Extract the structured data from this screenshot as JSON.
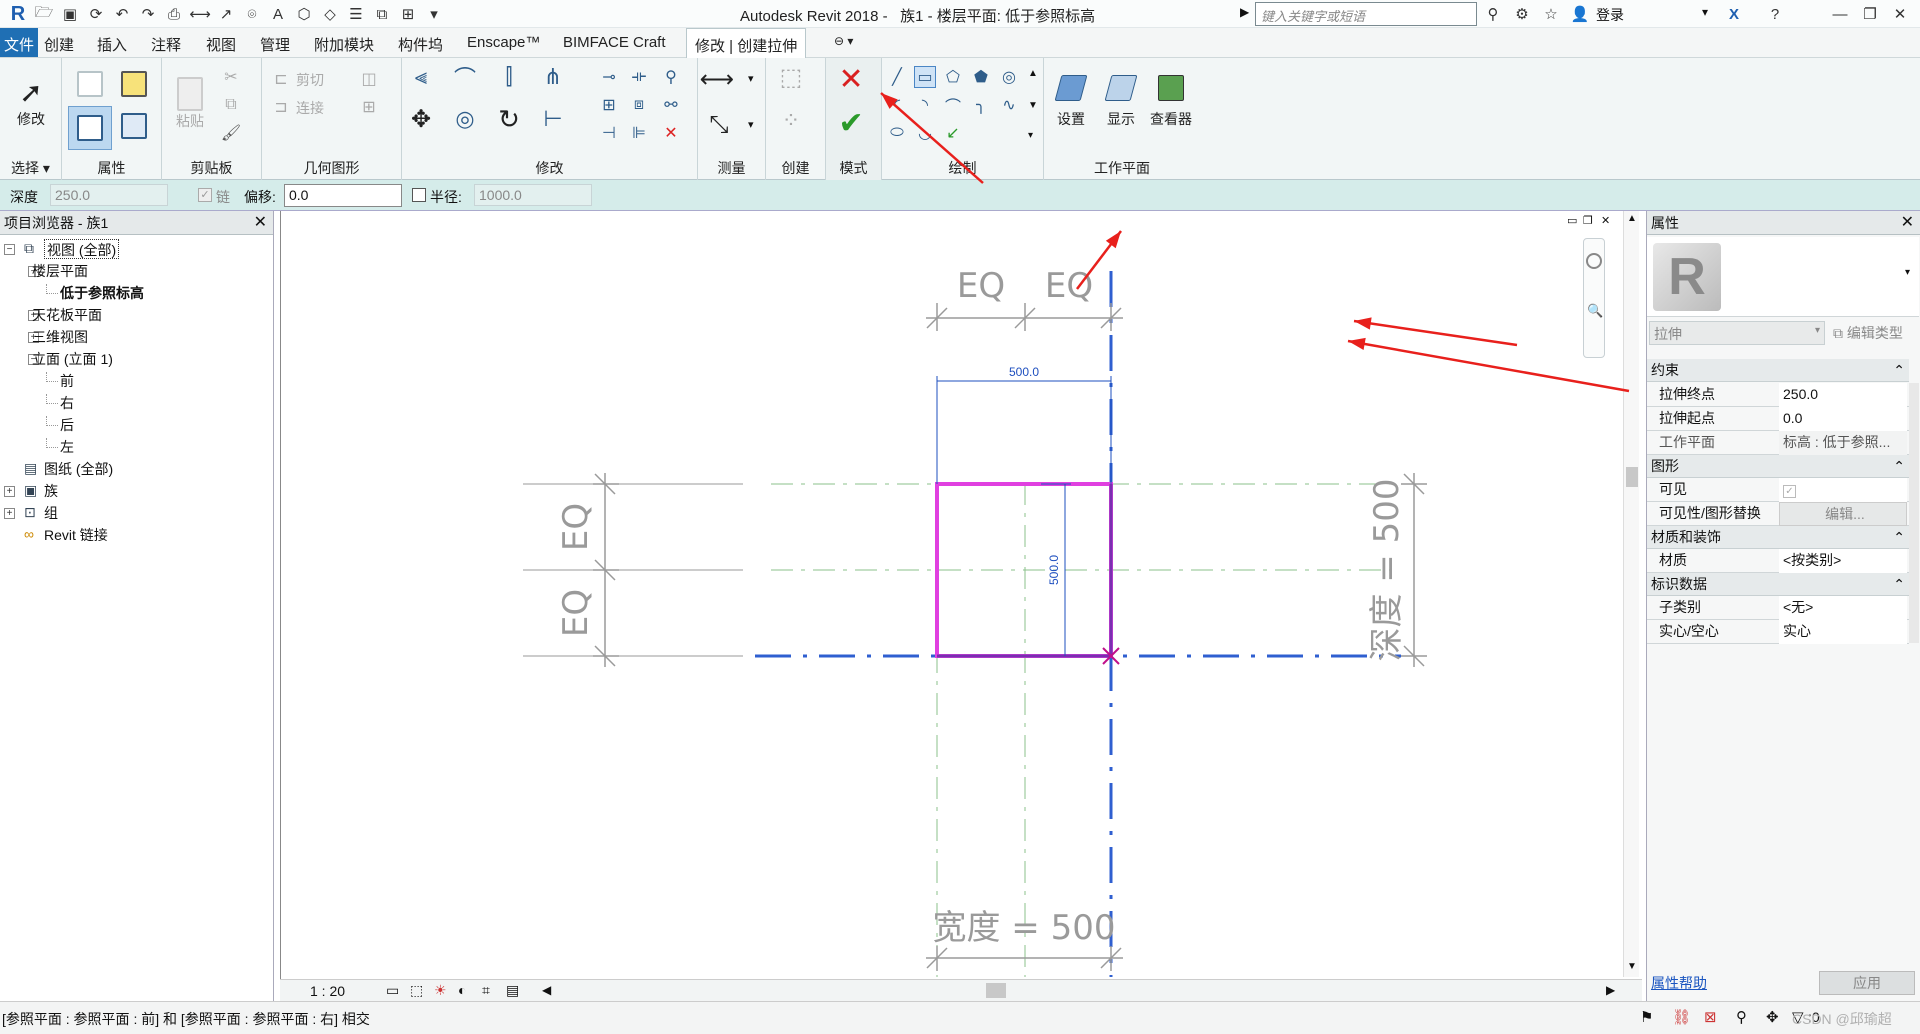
{
  "title_bar": {
    "app_title": "Autodesk Revit 2018 -",
    "doc_title": "族1 - 楼层平面: 低于参照标高",
    "search_placeholder": "键入关键字或短语",
    "login_label": "登录"
  },
  "menu": {
    "items": [
      "文件",
      "创建",
      "插入",
      "注释",
      "视图",
      "管理",
      "附加模块",
      "构件坞",
      "Enscape™",
      "BIMFACE Craft",
      "修改 | 创建拉伸"
    ]
  },
  "ribbon": {
    "select_panel": {
      "modify_label": "修改",
      "panel_label": "选择"
    },
    "properties_panel": {
      "panel_label": "属性"
    },
    "clipboard_panel": {
      "paste_label": "粘贴",
      "cut_label": "剪切",
      "join_label": "连接",
      "panel_label": "剪贴板"
    },
    "geometry_panel": {
      "panel_label": "几何图形"
    },
    "modify_panel": {
      "panel_label": "修改"
    },
    "measure_panel": {
      "panel_label": "测量"
    },
    "create_panel": {
      "panel_label": "创建"
    },
    "mode_panel": {
      "panel_label": "模式"
    },
    "draw_panel": {
      "panel_label": "绘制"
    },
    "workplane_panel": {
      "set_label": "设置",
      "show_label": "显示",
      "viewer_label": "查看器",
      "panel_label": "工作平面"
    }
  },
  "options_bar": {
    "depth_label": "深度",
    "depth_value": "250.0",
    "chain_label": "链",
    "offset_label": "偏移:",
    "offset_value": "0.0",
    "radius_label": "半径:",
    "radius_value": "1000.0"
  },
  "project_browser": {
    "title": "项目浏览器 - 族1",
    "items": [
      {
        "label": "视图 (全部)",
        "expander": "−"
      },
      {
        "label": "楼层平面",
        "expander": "−"
      },
      {
        "label": "低于参照标高",
        "expander": ""
      },
      {
        "label": "天花板平面",
        "expander": "+"
      },
      {
        "label": "三维视图",
        "expander": "+"
      },
      {
        "label": "立面 (立面 1)",
        "expander": "−"
      },
      {
        "label": "前",
        "expander": ""
      },
      {
        "label": "右",
        "expander": ""
      },
      {
        "label": "后",
        "expander": ""
      },
      {
        "label": "左",
        "expander": ""
      },
      {
        "label": "图纸 (全部)",
        "expander": ""
      },
      {
        "label": "族",
        "expander": "+"
      },
      {
        "label": "组",
        "expander": "+"
      },
      {
        "label": "Revit 链接",
        "expander": ""
      }
    ]
  },
  "drawing": {
    "eq_label": "EQ",
    "dim_500": "500.0",
    "width_label": "宽度 = 500",
    "depth_label": "深度 = 500",
    "sketch_color": "#e040e0",
    "ref_color": "#2f5fd0"
  },
  "view_control": {
    "scale": "1 : 20"
  },
  "properties": {
    "title": "属性",
    "type_selector": "拉伸",
    "edit_type": "编辑类型",
    "sections": {
      "constraints": "约束",
      "graphics": "图形",
      "materials": "材质和装饰",
      "identity": "标识数据"
    },
    "rows": {
      "extrusion_end": {
        "k": "拉伸终点",
        "v": "250.0"
      },
      "extrusion_start": {
        "k": "拉伸起点",
        "v": "0.0"
      },
      "work_plane": {
        "k": "工作平面",
        "v": "标高 : 低于参照..."
      },
      "visible": {
        "k": "可见",
        "v": ""
      },
      "vis_override": {
        "k": "可见性/图形替换",
        "v": "编辑..."
      },
      "material": {
        "k": "材质",
        "v": "<按类别>"
      },
      "subcategory": {
        "k": "子类别",
        "v": "<无>"
      },
      "solid_void": {
        "k": "实心/空心",
        "v": "实心"
      }
    },
    "help_link": "属性帮助",
    "apply_label": "应用"
  },
  "status": {
    "message": "[参照平面 : 参照平面 : 前] 和 [参照平面 : 参照平面 : 右] 相交",
    "filter_count": ":0",
    "watermark": "CSDN @邱瑜超"
  }
}
